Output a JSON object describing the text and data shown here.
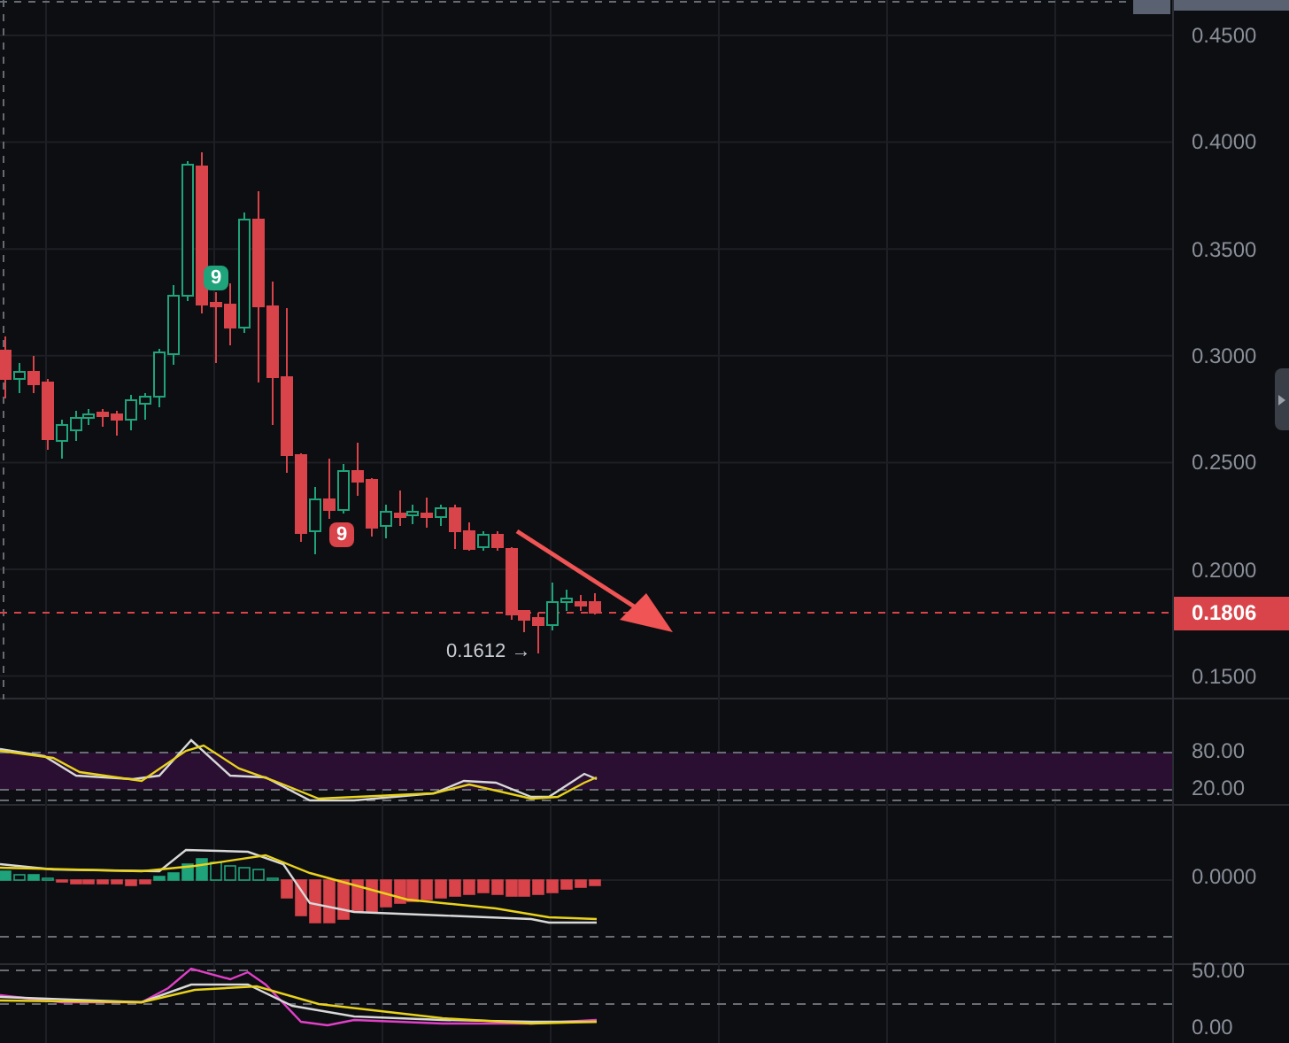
{
  "price_pane": {
    "axis_labels": [
      "0.4500",
      "0.4000",
      "0.3500",
      "0.3000",
      "0.2500",
      "0.2000",
      "0.1500"
    ],
    "current_price": "0.1806",
    "low_label": "0.1612 →",
    "markers": [
      {
        "text": "9",
        "kind": "buy"
      },
      {
        "text": "9",
        "kind": "sell"
      }
    ]
  },
  "stoch_pane": {
    "axis_labels": [
      "80.00",
      "20.00"
    ]
  },
  "macd_pane": {
    "axis_labels": [
      "0.0000"
    ]
  },
  "rsi_pane": {
    "axis_labels": [
      "50.00",
      "0.00"
    ]
  }
}
